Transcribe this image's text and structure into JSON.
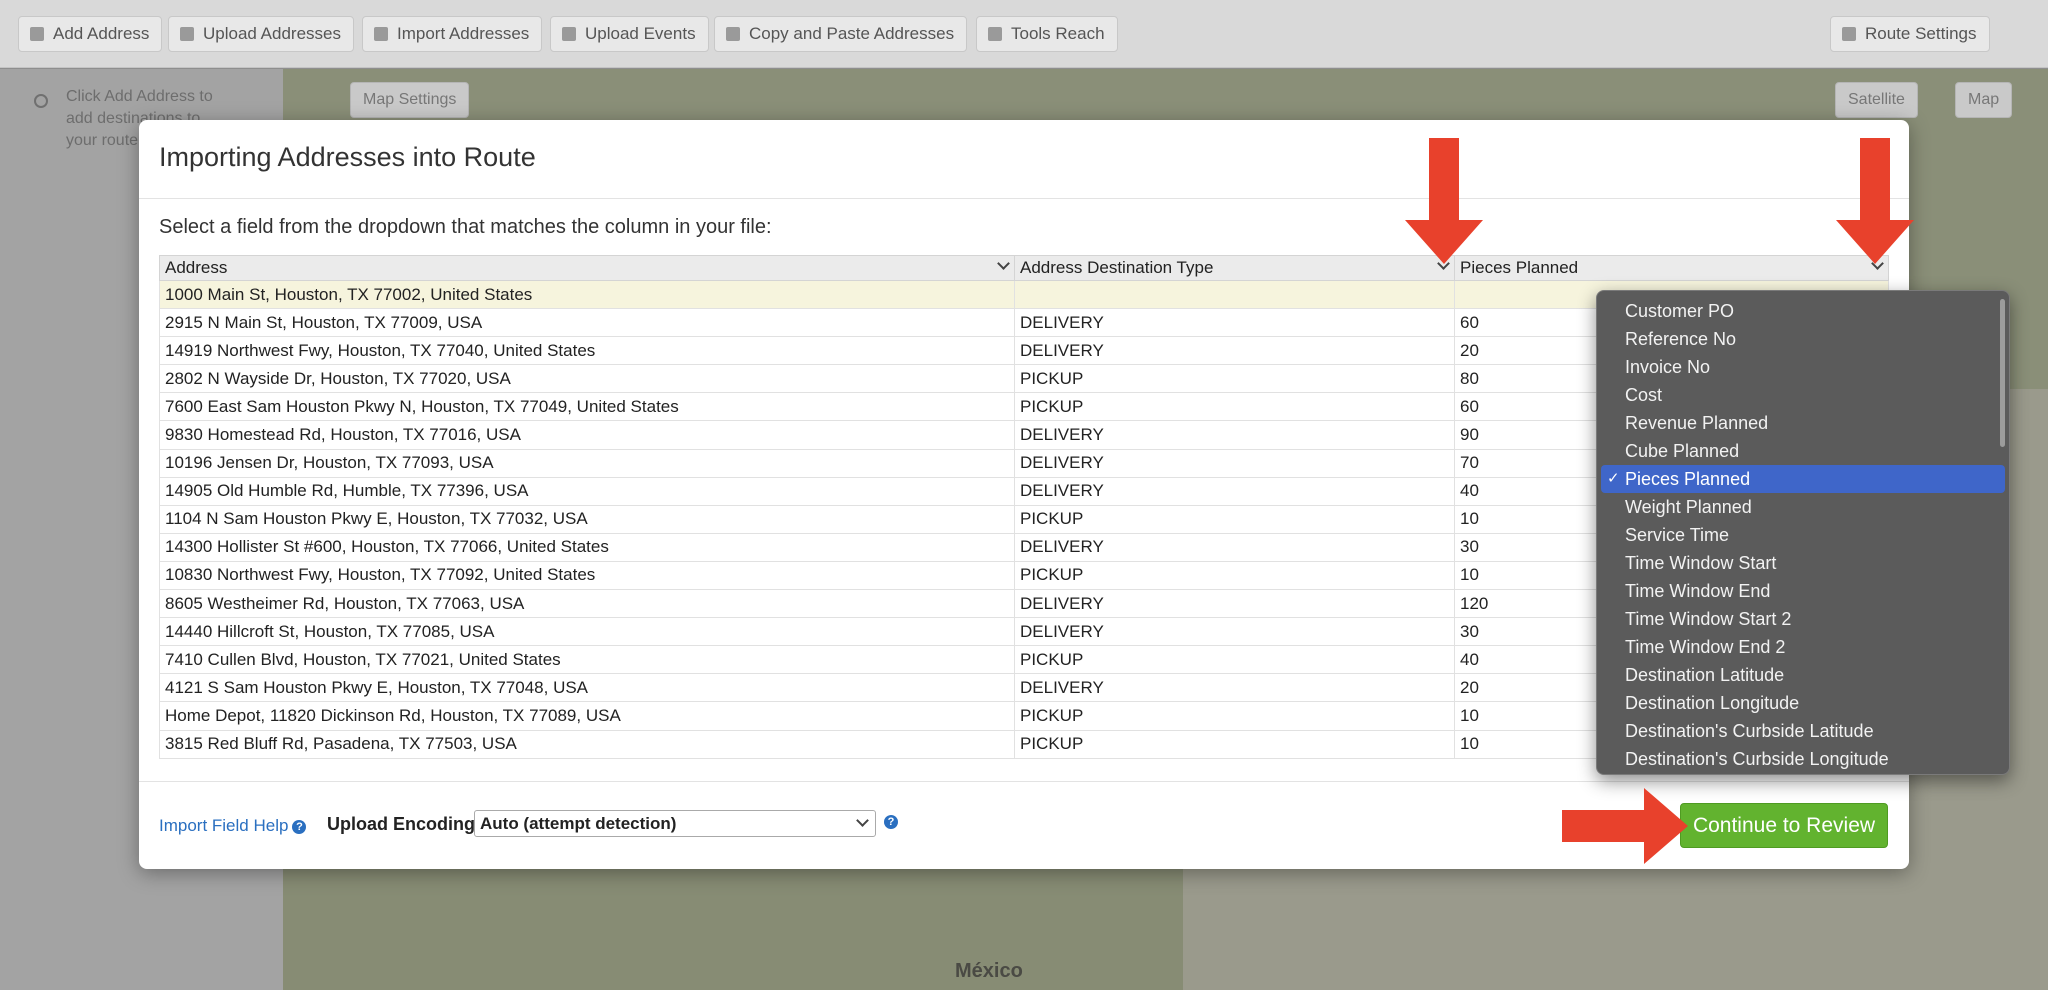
{
  "toolbar": {
    "buttons": [
      "Add Address",
      "Upload Addresses",
      "Import Addresses",
      "Upload Events",
      "Copy and Paste Addresses",
      "Tools Reach"
    ],
    "route_settings": "Route Settings"
  },
  "sidebar": {
    "hint": "Click Add Address to add destinations to your route"
  },
  "map": {
    "settings_label": "Map Settings",
    "btn_satellite": "Satellite",
    "btn_map": "Map",
    "label_mexico": "México"
  },
  "modal": {
    "title": "Importing Addresses into Route",
    "instruction": "Select a field from the dropdown that matches the column in your file:",
    "columns": [
      "Address",
      "Address Destination Type",
      "Pieces Planned"
    ],
    "rows": [
      [
        "1000 Main St, Houston, TX 77002, United States",
        "",
        ""
      ],
      [
        "2915 N Main St, Houston, TX 77009, USA",
        "DELIVERY",
        "60"
      ],
      [
        "14919 Northwest Fwy, Houston, TX 77040, United States",
        "DELIVERY",
        "20"
      ],
      [
        "2802 N Wayside Dr, Houston, TX 77020, USA",
        "PICKUP",
        "80"
      ],
      [
        "7600 East Sam Houston Pkwy N, Houston, TX 77049, United States",
        "PICKUP",
        "60"
      ],
      [
        "9830 Homestead Rd, Houston, TX 77016, USA",
        "DELIVERY",
        "90"
      ],
      [
        "10196 Jensen Dr, Houston, TX 77093, USA",
        "DELIVERY",
        "70"
      ],
      [
        "14905 Old Humble Rd, Humble, TX 77396, USA",
        "DELIVERY",
        "40"
      ],
      [
        "1104 N Sam Houston Pkwy E, Houston, TX 77032, USA",
        "PICKUP",
        "10"
      ],
      [
        "14300 Hollister St #600, Houston, TX 77066, United States",
        "DELIVERY",
        "30"
      ],
      [
        "10830 Northwest Fwy, Houston, TX 77092, United States",
        "PICKUP",
        "10"
      ],
      [
        "8605 Westheimer Rd, Houston, TX 77063, USA",
        "DELIVERY",
        "120"
      ],
      [
        "14440 Hillcroft St, Houston, TX 77085, USA",
        "DELIVERY",
        "30"
      ],
      [
        "7410 Cullen Blvd, Houston, TX 77021, United States",
        "PICKUP",
        "40"
      ],
      [
        "4121 S Sam Houston Pkwy E, Houston, TX 77048, USA",
        "DELIVERY",
        "20"
      ],
      [
        "Home Depot, 11820 Dickinson Rd, Houston, TX 77089, USA",
        "PICKUP",
        "10"
      ],
      [
        "3815 Red Bluff Rd, Pasadena, TX 77503, USA",
        "PICKUP",
        "10"
      ]
    ],
    "help_link": "Import Field Help",
    "help_icon": "?",
    "encoding_label": "Upload Encoding:",
    "encoding_value": "Auto (attempt detection)",
    "continue_label": "Continue to Review"
  },
  "dropdown": {
    "check": "✓",
    "selected_index": 6,
    "items": [
      "Customer PO",
      "Reference No",
      "Invoice No",
      "Cost",
      "Revenue Planned",
      "Cube Planned",
      "Pieces Planned",
      "Weight Planned",
      "Service Time",
      "Time Window Start",
      "Time Window End",
      "Time Window Start 2",
      "Time Window End 2",
      "Destination Latitude",
      "Destination Longitude",
      "Destination's Curbside Latitude",
      "Destination's Curbside Longitude"
    ]
  },
  "colors": {
    "arrow": "#e8412c",
    "continue": "#62b32f",
    "selection": "#3f66c9",
    "link": "#2a6fc0"
  }
}
